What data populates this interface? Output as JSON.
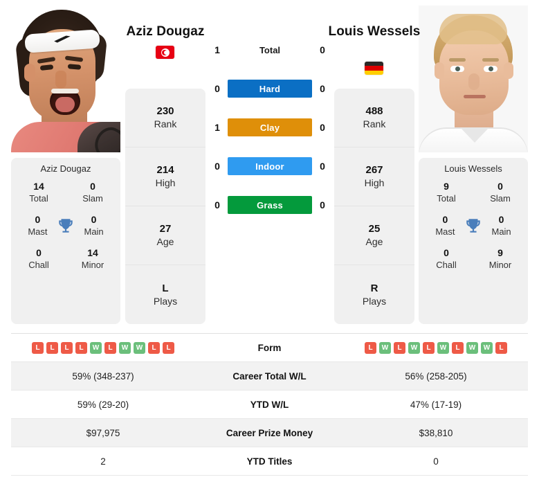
{
  "players": {
    "left": {
      "name": "Aziz Dougaz",
      "country_flag": "tunisia-flag",
      "panel_name": "Aziz Dougaz",
      "titles": {
        "total_value": "14",
        "total_label": "Total",
        "slam_value": "0",
        "slam_label": "Slam",
        "mast_value": "0",
        "mast_label": "Mast",
        "main_value": "0",
        "main_label": "Main",
        "chall_value": "0",
        "chall_label": "Chall",
        "minor_value": "14",
        "minor_label": "Minor"
      },
      "info": {
        "rank_value": "230",
        "rank_label": "Rank",
        "high_value": "214",
        "high_label": "High",
        "age_value": "27",
        "age_label": "Age",
        "plays_value": "L",
        "plays_label": "Plays"
      },
      "h2h": {
        "total": "1",
        "hard": "0",
        "clay": "1",
        "indoor": "0",
        "grass": "0"
      },
      "form": [
        "L",
        "L",
        "L",
        "L",
        "W",
        "L",
        "W",
        "W",
        "L",
        "L"
      ],
      "career_total_wl": "59% (348-237)",
      "ytd_wl": "59% (29-20)",
      "career_prize_money": "$97,975",
      "ytd_titles": "2"
    },
    "right": {
      "name": "Louis Wessels",
      "country_flag": "germany-flag",
      "panel_name": "Louis Wessels",
      "titles": {
        "total_value": "9",
        "total_label": "Total",
        "slam_value": "0",
        "slam_label": "Slam",
        "mast_value": "0",
        "mast_label": "Mast",
        "main_value": "0",
        "main_label": "Main",
        "chall_value": "0",
        "chall_label": "Chall",
        "minor_value": "9",
        "minor_label": "Minor"
      },
      "info": {
        "rank_value": "488",
        "rank_label": "Rank",
        "high_value": "267",
        "high_label": "High",
        "age_value": "25",
        "age_label": "Age",
        "plays_value": "R",
        "plays_label": "Plays"
      },
      "h2h": {
        "total": "0",
        "hard": "0",
        "clay": "0",
        "indoor": "0",
        "grass": "0"
      },
      "form": [
        "L",
        "W",
        "L",
        "W",
        "L",
        "W",
        "L",
        "W",
        "W",
        "L"
      ],
      "career_total_wl": "56% (258-205)",
      "ytd_wl": "47% (17-19)",
      "career_prize_money": "$38,810",
      "ytd_titles": "0"
    }
  },
  "surfaces": {
    "total_label": "Total",
    "hard_label": "Hard",
    "clay_label": "Clay",
    "indoor_label": "Indoor",
    "grass_label": "Grass"
  },
  "table_labels": {
    "form": "Form",
    "career_total_wl": "Career Total W/L",
    "ytd_wl": "YTD W/L",
    "career_prize_money": "Career Prize Money",
    "ytd_titles": "YTD Titles"
  },
  "colors": {
    "hard": "#0b6fc4",
    "clay": "#df8f09",
    "indoor": "#2f9bf0",
    "grass": "#049a3c",
    "win": "#6bbf7b",
    "loss": "#ee5a47",
    "trophy": "#4a7ebb",
    "panel_bg": "#f0f0f0"
  }
}
